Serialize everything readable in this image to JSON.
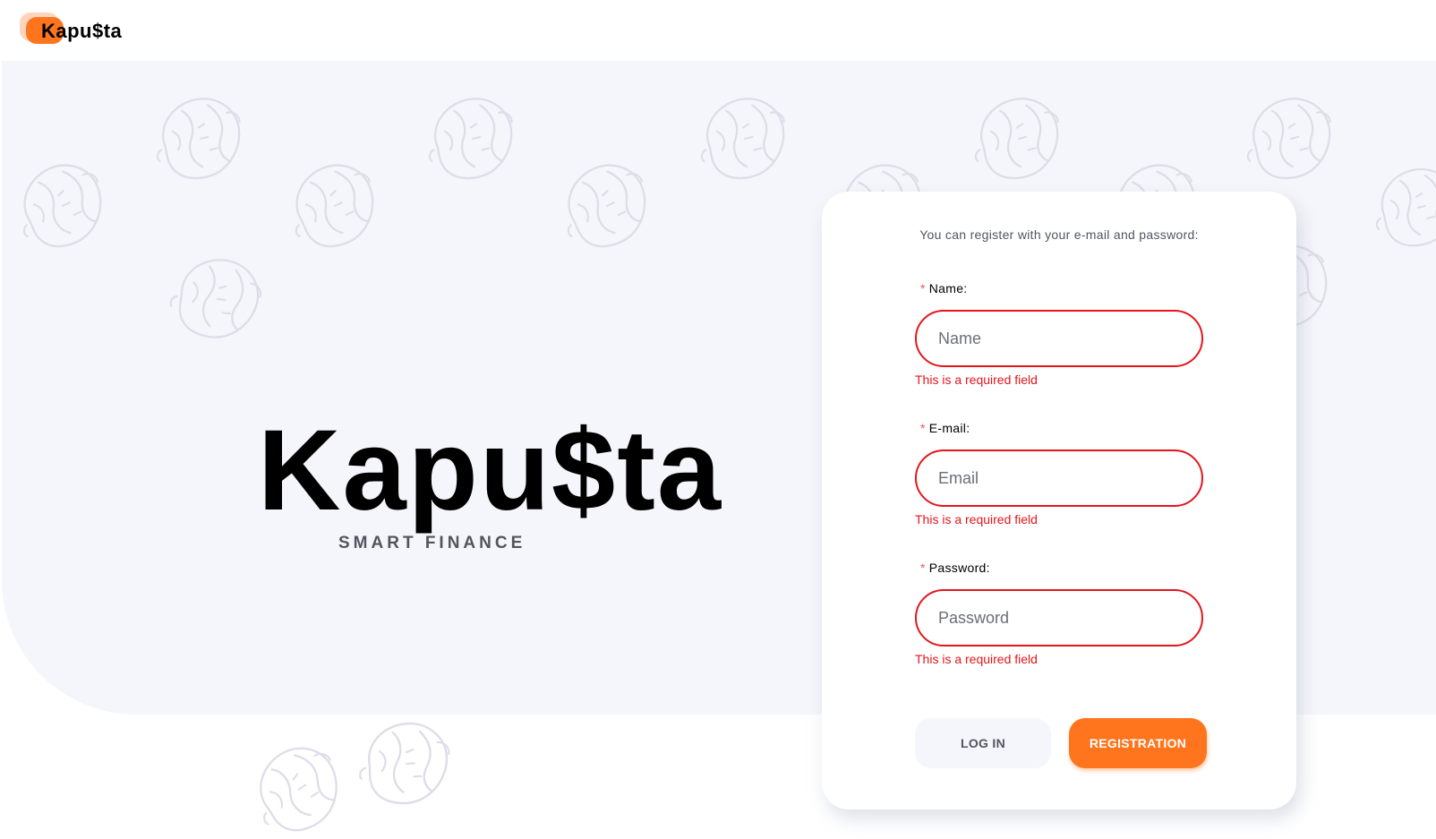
{
  "header": {
    "logo_text": "Kapu$ta"
  },
  "brand": {
    "title": "Kapu$ta",
    "subtitle": "SMART FINANCE"
  },
  "form": {
    "hint": "You can register with your e-mail and password:",
    "required_mark": "*",
    "fields": [
      {
        "label": "Name:",
        "placeholder": "Name",
        "error": "This is a required field"
      },
      {
        "label": "E-mail:",
        "placeholder": "Email",
        "error": "This is a required field"
      },
      {
        "label": "Password:",
        "placeholder": "Password",
        "error": "This is a required field"
      }
    ],
    "login_label": "LOG IN",
    "register_label": "REGISTRATION"
  },
  "colors": {
    "accent": "#ff751d",
    "hero_background": "#f5f6fb",
    "error": "#e3161c",
    "required_mark": "#eb5757"
  },
  "icons": [
    "cabbage-icon"
  ]
}
